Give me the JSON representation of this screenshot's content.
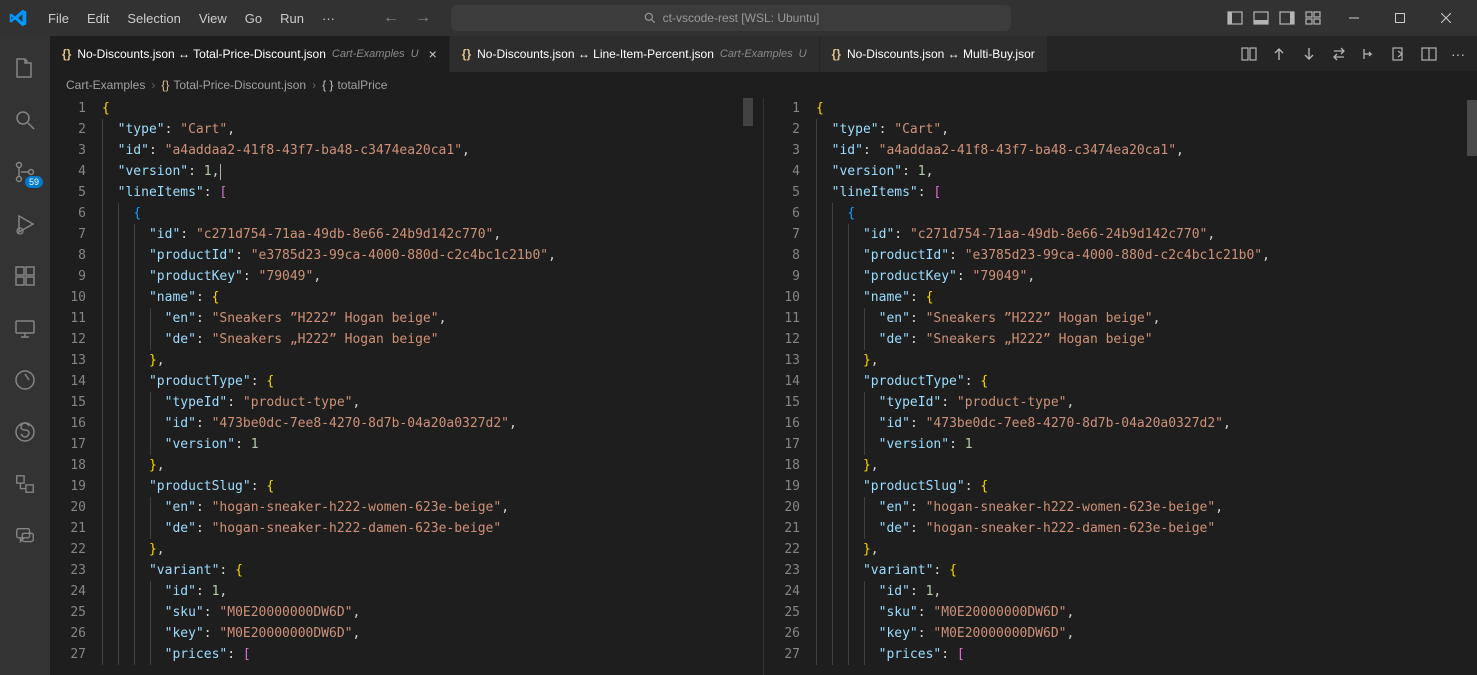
{
  "menubar": [
    "File",
    "Edit",
    "Selection",
    "View",
    "Go",
    "Run"
  ],
  "search_placeholder": "ct-vscode-rest [WSL: Ubuntu]",
  "badge_count": "59",
  "tabs": [
    {
      "label": "No-Discounts.json ↔ Total-Price-Discount.json",
      "sub": "Cart-Examples",
      "mod": "U",
      "active": true,
      "closeable": true
    },
    {
      "label": "No-Discounts.json ↔ Line-Item-Percent.json",
      "sub": "Cart-Examples",
      "mod": "U",
      "active": false,
      "closeable": false
    },
    {
      "label": "No-Discounts.json ↔ Multi-Buy.jsor",
      "sub": "",
      "mod": "",
      "active": false,
      "closeable": false
    }
  ],
  "breadcrumbs": [
    "Cart-Examples",
    "Total-Price-Discount.json",
    "totalPrice"
  ],
  "code_lines": [
    {
      "i": 0,
      "tokens": [
        [
          "brk-y",
          "{",
          " "
        ]
      ]
    },
    {
      "i": 1,
      "tokens": [
        [
          "key",
          "\"type\""
        ],
        [
          "punc",
          ": "
        ],
        [
          "str",
          "\"Cart\""
        ],
        [
          "punc",
          ","
        ]
      ]
    },
    {
      "i": 1,
      "tokens": [
        [
          "key",
          "\"id\""
        ],
        [
          "punc",
          ": "
        ],
        [
          "str",
          "\"a4addaa2-41f8-43f7-ba48-c3474ea20ca1\""
        ],
        [
          "punc",
          ","
        ]
      ]
    },
    {
      "i": 1,
      "tokens": [
        [
          "key",
          "\"version\""
        ],
        [
          "punc",
          ": "
        ],
        [
          "num",
          "1"
        ],
        [
          "punc",
          ","
        ]
      ],
      "cursor_left": true
    },
    {
      "i": 1,
      "tokens": [
        [
          "key",
          "\"lineItems\""
        ],
        [
          "punc",
          ": "
        ],
        [
          "brk-p",
          "["
        ]
      ]
    },
    {
      "i": 2,
      "tokens": [
        [
          "brk-b",
          "{"
        ]
      ]
    },
    {
      "i": 3,
      "tokens": [
        [
          "key",
          "\"id\""
        ],
        [
          "punc",
          ": "
        ],
        [
          "str",
          "\"c271d754-71aa-49db-8e66-24b9d142c770\""
        ],
        [
          "punc",
          ","
        ]
      ]
    },
    {
      "i": 3,
      "tokens": [
        [
          "key",
          "\"productId\""
        ],
        [
          "punc",
          ": "
        ],
        [
          "str",
          "\"e3785d23-99ca-4000-880d-c2c4bc1c21b0\""
        ],
        [
          "punc",
          ","
        ]
      ]
    },
    {
      "i": 3,
      "tokens": [
        [
          "key",
          "\"productKey\""
        ],
        [
          "punc",
          ": "
        ],
        [
          "str",
          "\"79049\""
        ],
        [
          "punc",
          ","
        ]
      ]
    },
    {
      "i": 3,
      "tokens": [
        [
          "key",
          "\"name\""
        ],
        [
          "punc",
          ": "
        ],
        [
          "brk-y",
          "{"
        ]
      ]
    },
    {
      "i": 4,
      "tokens": [
        [
          "key",
          "\"en\""
        ],
        [
          "punc",
          ": "
        ],
        [
          "str",
          "\"Sneakers ”H222” Hogan beige\""
        ],
        [
          "punc",
          ","
        ]
      ]
    },
    {
      "i": 4,
      "tokens": [
        [
          "key",
          "\"de\""
        ],
        [
          "punc",
          ": "
        ],
        [
          "str",
          "\"Sneakers „H222” Hogan beige\""
        ]
      ]
    },
    {
      "i": 3,
      "tokens": [
        [
          "brk-y",
          "}"
        ],
        [
          "punc",
          ","
        ]
      ]
    },
    {
      "i": 3,
      "tokens": [
        [
          "key",
          "\"productType\""
        ],
        [
          "punc",
          ": "
        ],
        [
          "brk-y",
          "{"
        ]
      ]
    },
    {
      "i": 4,
      "tokens": [
        [
          "key",
          "\"typeId\""
        ],
        [
          "punc",
          ": "
        ],
        [
          "str",
          "\"product-type\""
        ],
        [
          "punc",
          ","
        ]
      ]
    },
    {
      "i": 4,
      "tokens": [
        [
          "key",
          "\"id\""
        ],
        [
          "punc",
          ": "
        ],
        [
          "str",
          "\"473be0dc-7ee8-4270-8d7b-04a20a0327d2\""
        ],
        [
          "punc",
          ","
        ]
      ]
    },
    {
      "i": 4,
      "tokens": [
        [
          "key",
          "\"version\""
        ],
        [
          "punc",
          ": "
        ],
        [
          "num",
          "1"
        ]
      ]
    },
    {
      "i": 3,
      "tokens": [
        [
          "brk-y",
          "}"
        ],
        [
          "punc",
          ","
        ]
      ]
    },
    {
      "i": 3,
      "tokens": [
        [
          "key",
          "\"productSlug\""
        ],
        [
          "punc",
          ": "
        ],
        [
          "brk-y",
          "{"
        ]
      ]
    },
    {
      "i": 4,
      "tokens": [
        [
          "key",
          "\"en\""
        ],
        [
          "punc",
          ": "
        ],
        [
          "str",
          "\"hogan-sneaker-h222-women-623e-beige\""
        ],
        [
          "punc",
          ","
        ]
      ]
    },
    {
      "i": 4,
      "tokens": [
        [
          "key",
          "\"de\""
        ],
        [
          "punc",
          ": "
        ],
        [
          "str",
          "\"hogan-sneaker-h222-damen-623e-beige\""
        ]
      ]
    },
    {
      "i": 3,
      "tokens": [
        [
          "brk-y",
          "}"
        ],
        [
          "punc",
          ","
        ]
      ]
    },
    {
      "i": 3,
      "tokens": [
        [
          "key",
          "\"variant\""
        ],
        [
          "punc",
          ": "
        ],
        [
          "brk-y",
          "{"
        ]
      ]
    },
    {
      "i": 4,
      "tokens": [
        [
          "key",
          "\"id\""
        ],
        [
          "punc",
          ": "
        ],
        [
          "num",
          "1"
        ],
        [
          "punc",
          ","
        ]
      ]
    },
    {
      "i": 4,
      "tokens": [
        [
          "key",
          "\"sku\""
        ],
        [
          "punc",
          ": "
        ],
        [
          "str",
          "\"M0E20000000DW6D\""
        ],
        [
          "punc",
          ","
        ]
      ]
    },
    {
      "i": 4,
      "tokens": [
        [
          "key",
          "\"key\""
        ],
        [
          "punc",
          ": "
        ],
        [
          "str",
          "\"M0E20000000DW6D\""
        ],
        [
          "punc",
          ","
        ]
      ]
    },
    {
      "i": 4,
      "tokens": [
        [
          "key",
          "\"prices\""
        ],
        [
          "punc",
          ": "
        ],
        [
          "brk-p",
          "["
        ]
      ]
    }
  ]
}
